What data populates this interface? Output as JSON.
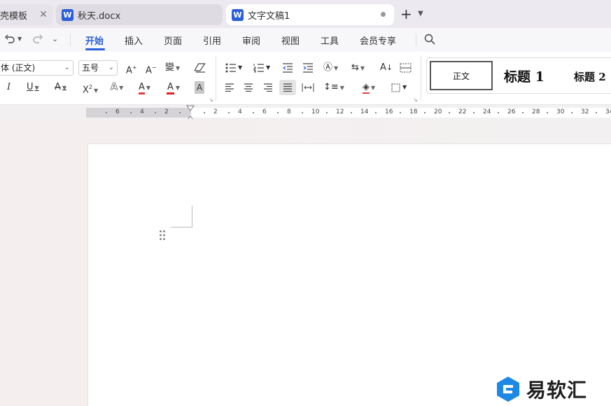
{
  "tabs": [
    {
      "label": "壳模板",
      "close": "✕"
    },
    {
      "label": "秋天.docx",
      "icon": "W"
    },
    {
      "label": "文字文稿1",
      "icon": "W"
    }
  ],
  "new_tab": "+",
  "menu": [
    "开始",
    "插入",
    "页面",
    "引用",
    "审阅",
    "视图",
    "工具",
    "会员专享"
  ],
  "font": {
    "name": "体 (正文)",
    "size": "五号"
  },
  "toolbar": {
    "grow_font": "A",
    "shrink_font": "A",
    "phonetic": "變",
    "italic": "I",
    "underline": "U",
    "strike": "A",
    "superscript": "X",
    "text_effect": "A",
    "highlight": "A",
    "font_color": "A",
    "char_shade": "A",
    "sort": "A"
  },
  "styles": {
    "body": "正文",
    "heading1": "标题  1",
    "heading2": "标题  2"
  },
  "ruler": {
    "left": [
      "6",
      "4",
      "2"
    ],
    "right": [
      "2",
      "4",
      "6",
      "8",
      "10",
      "12",
      "14",
      "16",
      "18",
      "20",
      "22",
      "24",
      "26",
      "28",
      "30",
      "32",
      "34"
    ]
  },
  "watermark": {
    "text": "易软汇"
  },
  "colors": {
    "accent": "#2b5fd9",
    "font_color": "#e02020",
    "highlight": "#e04040",
    "watermark_icon": "#1e88e5"
  }
}
